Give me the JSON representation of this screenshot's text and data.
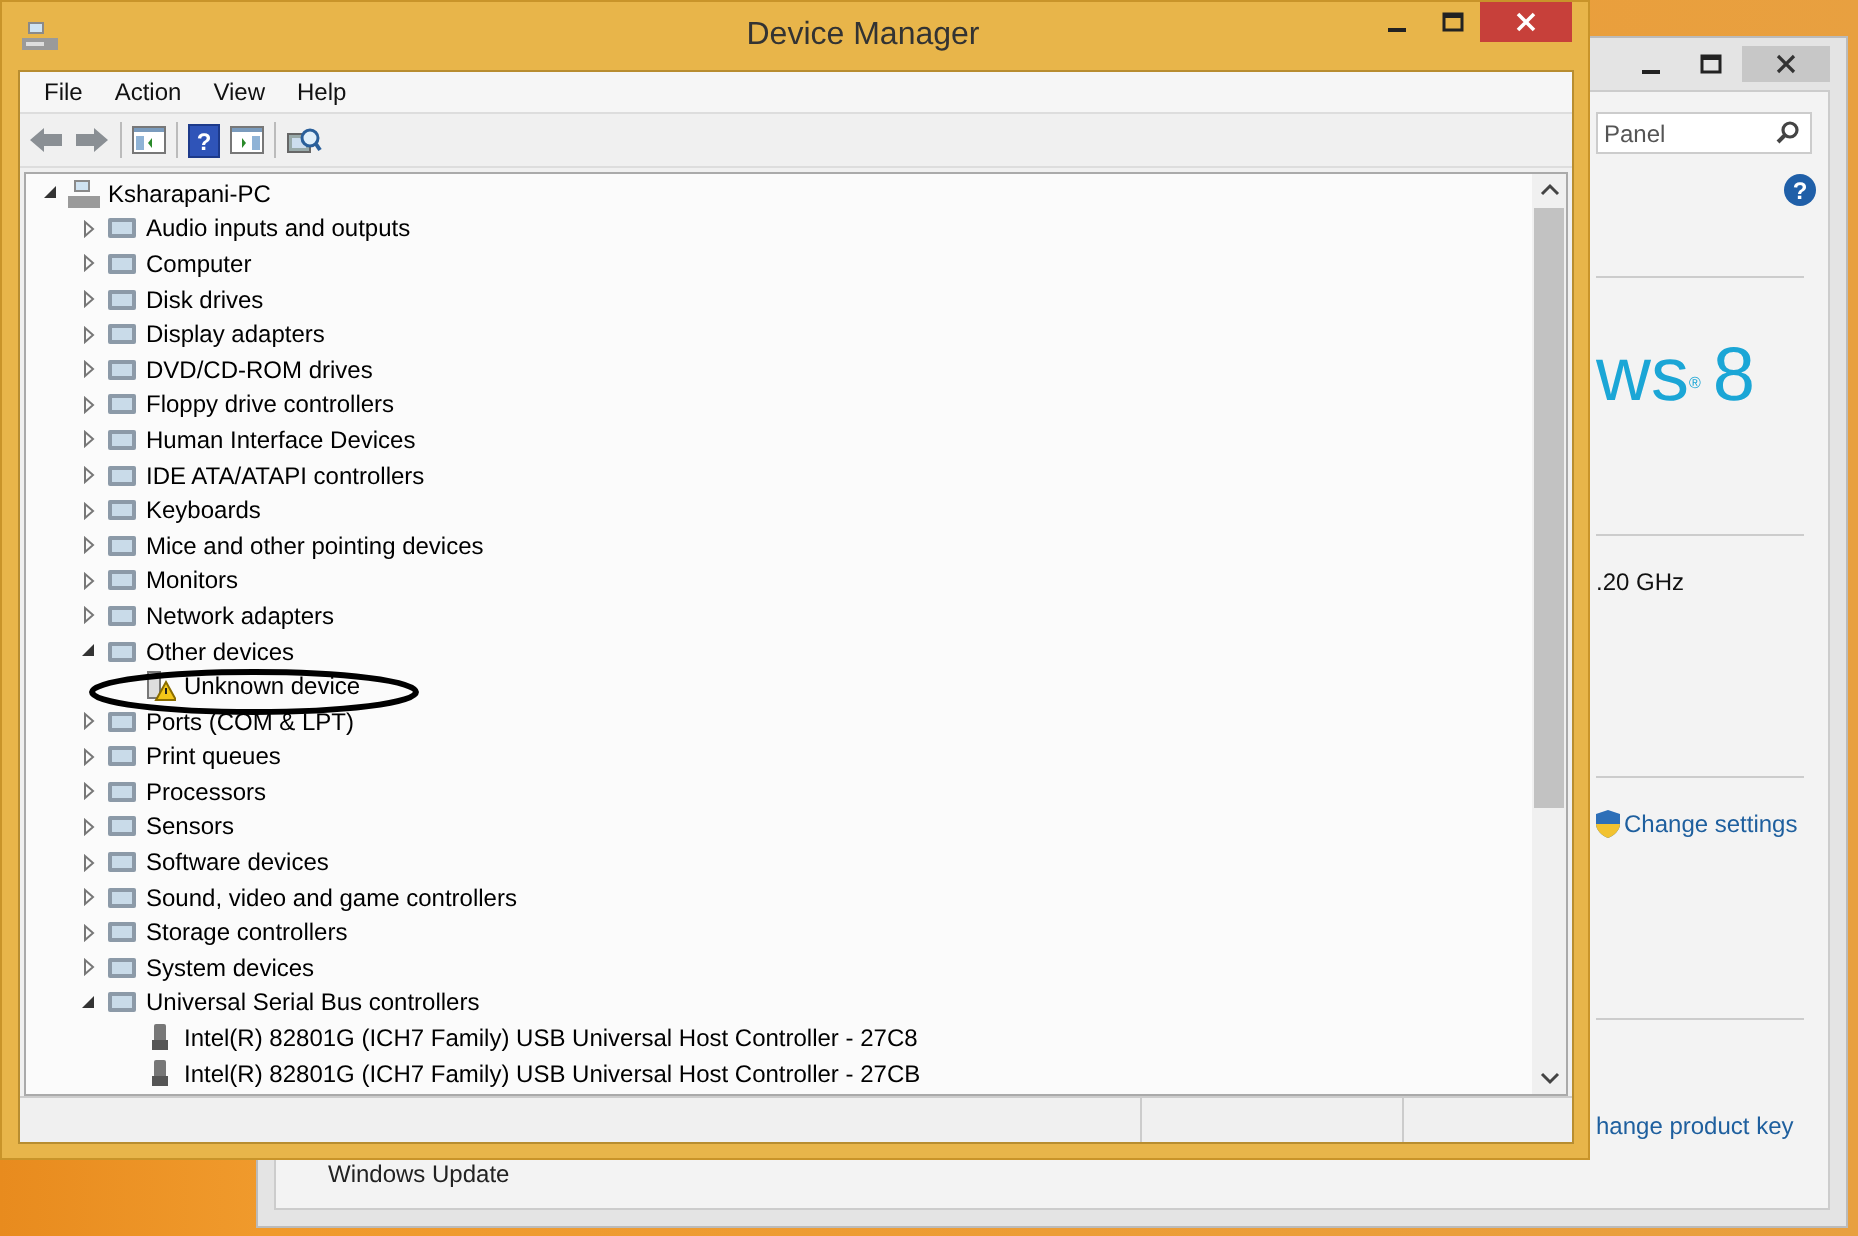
{
  "background_window": {
    "search": {
      "placeholder": "Panel"
    },
    "help_glyph": "?",
    "logo": {
      "text": "ws",
      "mark": "®",
      "number": "8"
    },
    "processor_speed": ".20 GHz",
    "change_settings": "Change settings",
    "windows_update": "Windows Update",
    "change_product_key": "hange product key"
  },
  "window": {
    "title": "Device Manager"
  },
  "menu": [
    "File",
    "Action",
    "View",
    "Help"
  ],
  "toolbar": {
    "help_glyph": "?"
  },
  "tree": {
    "label": "Ksharapani-PC",
    "expanded": true,
    "children": [
      {
        "label": "Audio inputs and outputs",
        "expanded": false
      },
      {
        "label": "Computer",
        "expanded": false
      },
      {
        "label": "Disk drives",
        "expanded": false
      },
      {
        "label": "Display adapters",
        "expanded": false
      },
      {
        "label": "DVD/CD-ROM drives",
        "expanded": false
      },
      {
        "label": "Floppy drive controllers",
        "expanded": false
      },
      {
        "label": "Human Interface Devices",
        "expanded": false
      },
      {
        "label": "IDE ATA/ATAPI controllers",
        "expanded": false
      },
      {
        "label": "Keyboards",
        "expanded": false
      },
      {
        "label": "Mice and other pointing devices",
        "expanded": false
      },
      {
        "label": "Monitors",
        "expanded": false
      },
      {
        "label": "Network adapters",
        "expanded": false
      },
      {
        "label": "Other devices",
        "expanded": true,
        "children": [
          {
            "label": "Unknown device",
            "warning": true
          }
        ]
      },
      {
        "label": "Ports (COM & LPT)",
        "expanded": false
      },
      {
        "label": "Print queues",
        "expanded": false
      },
      {
        "label": "Processors",
        "expanded": false
      },
      {
        "label": "Sensors",
        "expanded": false
      },
      {
        "label": "Software devices",
        "expanded": false
      },
      {
        "label": "Sound, video and game controllers",
        "expanded": false
      },
      {
        "label": "Storage controllers",
        "expanded": false
      },
      {
        "label": "System devices",
        "expanded": false
      },
      {
        "label": "Universal Serial Bus controllers",
        "expanded": true,
        "children": [
          {
            "label": "Intel(R) 82801G (ICH7 Family) USB Universal Host Controller - 27C8",
            "warning": false
          },
          {
            "label": "Intel(R) 82801G (ICH7 Family) USB Universal Host Controller - 27CB",
            "warning": false
          }
        ]
      }
    ]
  }
}
